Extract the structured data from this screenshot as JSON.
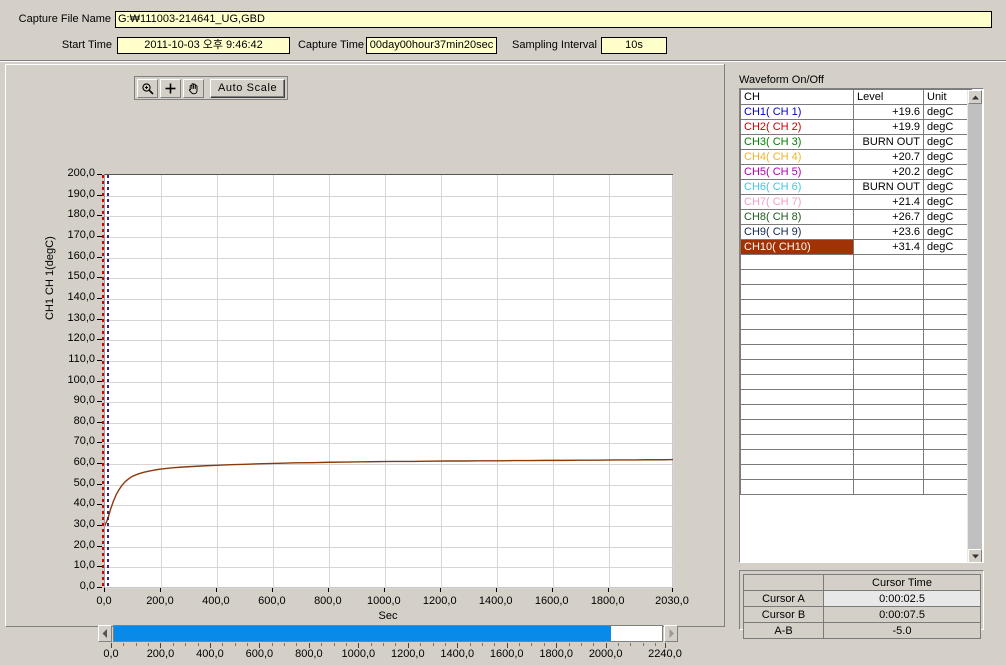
{
  "header": {
    "file_label": "Capture File Name",
    "file_value": "G:₩111003-214641_UG,GBD",
    "start_label": "Start Time",
    "start_value": "2011-10-03 오후 9:46:42",
    "capture_label": "Capture Time",
    "capture_value": "00day00hour37min20sec",
    "sampling_label": "Sampling Interval",
    "sampling_value": "10s"
  },
  "toolbar": {
    "zoom_icon": "magnifier-zoom-icon",
    "crosshair_icon": "crosshair-icon",
    "pan_icon": "hand-pan-icon",
    "autoscale_label": "Auto Scale"
  },
  "waveform": {
    "title": "Waveform On/Off",
    "columns": [
      "CH",
      "Level",
      "Unit"
    ],
    "rows": [
      {
        "ch": "CH1( CH 1)",
        "level": "+19.6",
        "unit": "degC",
        "color": "#0000cd",
        "selected": false
      },
      {
        "ch": "CH2( CH 2)",
        "level": "+19.9",
        "unit": "degC",
        "color": "#cc0000",
        "selected": false
      },
      {
        "ch": "CH3( CH 3)",
        "level": "BURN OUT",
        "unit": "degC",
        "color": "#008000",
        "selected": false
      },
      {
        "ch": "CH4( CH 4)",
        "level": "+20.7",
        "unit": "degC",
        "color": "#f0b428",
        "selected": false
      },
      {
        "ch": "CH5( CH 5)",
        "level": "+20.2",
        "unit": "degC",
        "color": "#b000b0",
        "selected": false
      },
      {
        "ch": "CH6( CH 6)",
        "level": "BURN OUT",
        "unit": "degC",
        "color": "#3cc8e6",
        "selected": false
      },
      {
        "ch": "CH7( CH 7)",
        "level": "+21.4",
        "unit": "degC",
        "color": "#f0a0c8",
        "selected": false
      },
      {
        "ch": "CH8( CH 8)",
        "level": "+26.7",
        "unit": "degC",
        "color": "#1e5a1e",
        "selected": false
      },
      {
        "ch": "CH9( CH 9)",
        "level": "+23.6",
        "unit": "degC",
        "color": "#102850",
        "selected": false
      },
      {
        "ch": "CH10( CH10)",
        "level": "+31.4",
        "unit": "degC",
        "color": "#ffffff",
        "selected": true
      }
    ],
    "empty_row_count": 16,
    "scroll_up_icon": "scroll-up-arrow-icon",
    "scroll_down_icon": "scroll-down-arrow-icon"
  },
  "cursor_table": {
    "corner": "",
    "header": "Cursor Time",
    "rows": [
      {
        "label": "Cursor A",
        "value": "0:00:02.5"
      },
      {
        "label": "Cursor B",
        "value": "0:00:07.5"
      },
      {
        "label": "A-B",
        "value": "-5.0"
      }
    ]
  },
  "range_bar": {
    "left_arrow_icon": "left-arrow-icon",
    "right_arrow_icon": "right-arrow-icon",
    "min": 0,
    "max": 2240,
    "fill_end": 2030,
    "ticks": [
      "0,0",
      "200,0",
      "400,0",
      "600,0",
      "800,0",
      "1000,0",
      "1200,0",
      "1400,0",
      "1600,0",
      "1800,0",
      "2000,0",
      "2240,0"
    ],
    "fill_color": "#0a8ae8"
  },
  "chart_data": {
    "type": "line",
    "title": "",
    "xlabel": "Sec",
    "ylabel": "CH1  CH 1(degC)",
    "xlim": [
      0,
      2030
    ],
    "ylim": [
      0,
      200
    ],
    "grid": true,
    "legend": "none",
    "ytick_labels": [
      "200,0",
      "190,0",
      "180,0",
      "170,0",
      "160,0",
      "150,0",
      "140,0",
      "130,0",
      "120,0",
      "110,0",
      "100,0",
      "90,0",
      "80,0",
      "70,0",
      "60,0",
      "50,0",
      "40,0",
      "30,0",
      "20,0",
      "10,0",
      "0,0"
    ],
    "ytick_values": [
      200,
      190,
      180,
      170,
      160,
      150,
      140,
      130,
      120,
      110,
      100,
      90,
      80,
      70,
      60,
      50,
      40,
      30,
      20,
      10,
      0
    ],
    "xtick_labels": [
      "0,0",
      "200,0",
      "400,0",
      "600,0",
      "800,0",
      "1000,0",
      "1200,0",
      "1400,0",
      "1600,0",
      "1800,0",
      "2030,0"
    ],
    "xtick_values": [
      0,
      200,
      400,
      600,
      800,
      1000,
      1200,
      1400,
      1600,
      1800,
      2030
    ],
    "cursors": [
      {
        "name": "Cursor A",
        "x": 2.5,
        "color": "#cc0000"
      },
      {
        "name": "Cursor B",
        "x": 7.5,
        "color": "#40207a"
      }
    ],
    "series": [
      {
        "name": "CH10( CH10)",
        "color": "#8b3a0a",
        "x": [
          0,
          10,
          20,
          30,
          40,
          50,
          60,
          70,
          80,
          90,
          100,
          120,
          140,
          160,
          180,
          200,
          240,
          280,
          320,
          360,
          400,
          450,
          500,
          560,
          620,
          680,
          740,
          800,
          860,
          920,
          980,
          1040,
          1100,
          1160,
          1220,
          1280,
          1340,
          1400,
          1460,
          1520,
          1580,
          1640,
          1700,
          1760,
          1820,
          1880,
          1940,
          2000,
          2030
        ],
        "y": [
          30.4,
          33.5,
          38.2,
          42.0,
          45.2,
          47.6,
          49.6,
          51.2,
          52.4,
          53.4,
          54.2,
          55.3,
          56.1,
          56.7,
          57.2,
          57.6,
          58.2,
          58.6,
          58.9,
          59.2,
          59.4,
          59.7,
          59.9,
          60.2,
          60.4,
          60.6,
          60.7,
          60.9,
          61.0,
          61.1,
          61.2,
          61.3,
          61.3,
          61.4,
          61.5,
          61.5,
          61.6,
          61.6,
          61.7,
          61.7,
          61.8,
          61.8,
          61.9,
          61.9,
          62.0,
          62.0,
          62.1,
          62.1,
          62.2
        ]
      }
    ]
  }
}
